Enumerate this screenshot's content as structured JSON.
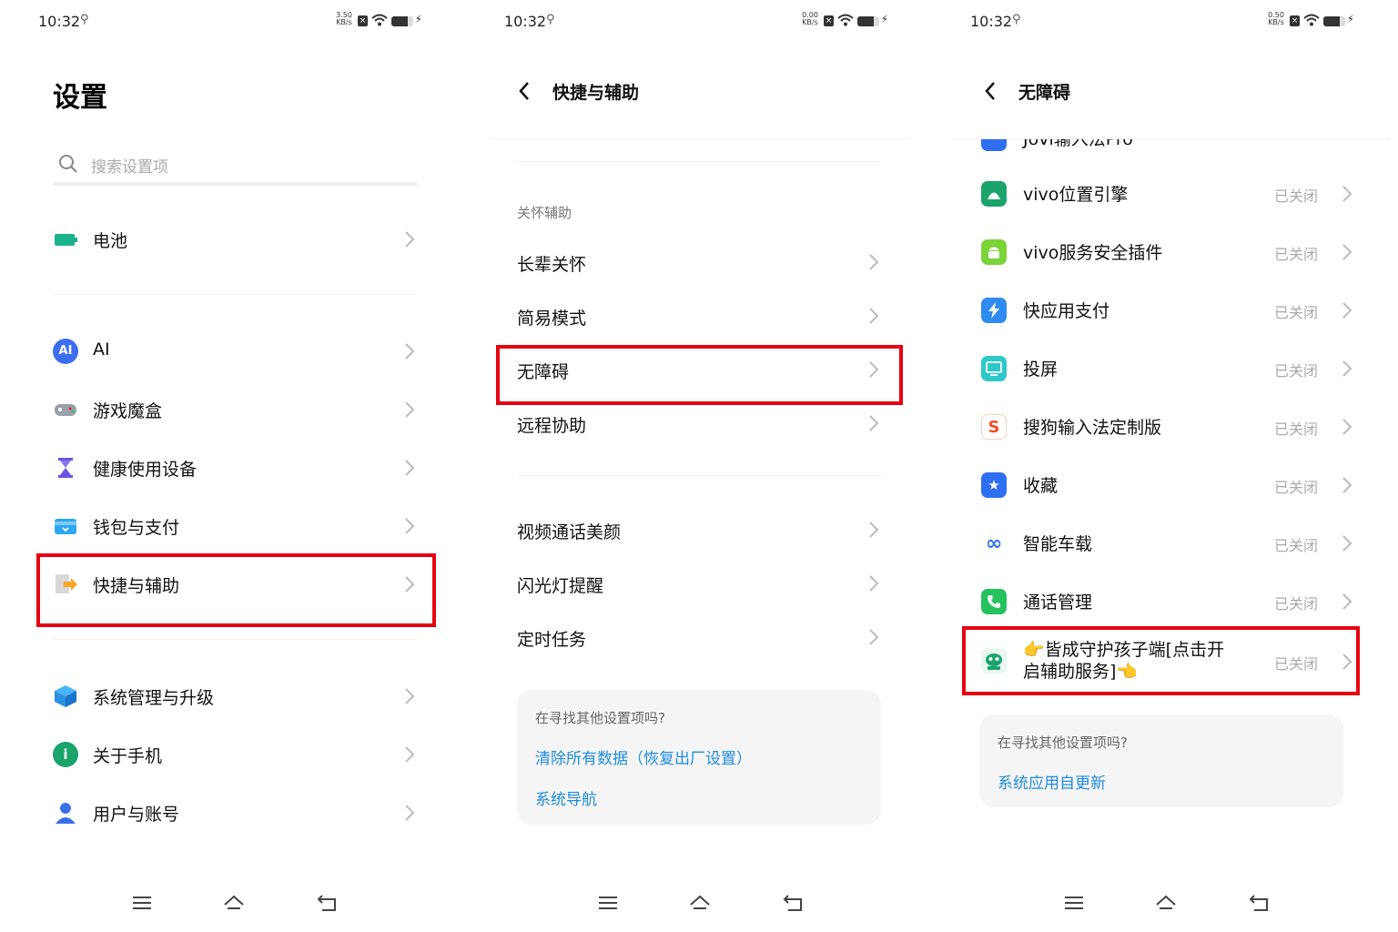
{
  "status": [
    {
      "time": "10:32",
      "net_speed": "3.50",
      "net_unit": "KB/s",
      "battery_level": 0.75
    },
    {
      "time": "10:32",
      "net_speed": "0.00",
      "net_unit": "KB/s",
      "battery_level": 0.75
    },
    {
      "time": "10:32",
      "net_speed": "0.50",
      "net_unit": "KB/s",
      "battery_level": 0.75
    }
  ],
  "settings": {
    "title": "设置",
    "search_placeholder": "搜索设置项",
    "items": [
      {
        "label": "电池",
        "icon": "battery-icon"
      },
      {
        "label": "AI",
        "icon": "ai-icon"
      },
      {
        "label": "游戏魔盒",
        "icon": "gamepad-icon"
      },
      {
        "label": "健康使用设备",
        "icon": "hourglass-icon"
      },
      {
        "label": "钱包与支付",
        "icon": "wallet-icon"
      },
      {
        "label": "快捷与辅助",
        "icon": "shortcut-icon"
      },
      {
        "label": "系统管理与升级",
        "icon": "system-icon"
      },
      {
        "label": "关于手机",
        "icon": "info-icon"
      },
      {
        "label": "用户与账号",
        "icon": "user-icon"
      }
    ]
  },
  "shortcuts": {
    "title": "快捷与辅助",
    "section_label": "关怀辅助",
    "items": [
      "长辈关怀",
      "简易模式",
      "无障碍",
      "远程协助",
      "视频通话美颜",
      "闪光灯提醒",
      "定时任务"
    ],
    "card": {
      "question": "在寻找其他设置项吗?",
      "links": [
        "清除所有数据（恢复出厂设置）",
        "系统导航"
      ]
    }
  },
  "accessibility": {
    "title": "无障碍",
    "partial_top_label": "Jovi输入法Pro",
    "items": [
      {
        "label": "vivo位置引擎",
        "state": "已关闭",
        "icon": "android-icon",
        "color": "#1aa36b"
      },
      {
        "label": "vivo服务安全插件",
        "state": "已关闭",
        "icon": "android-icon",
        "color": "#7bd438"
      },
      {
        "label": "快应用支付",
        "state": "已关闭",
        "icon": "lightning-icon",
        "color": "#2f8bf0"
      },
      {
        "label": "投屏",
        "state": "已关闭",
        "icon": "screen-cast-icon",
        "color": "#2fc8c8"
      },
      {
        "label": "搜狗输入法定制版",
        "state": "已关闭",
        "icon": "sogou-icon",
        "color": "#f04e23"
      },
      {
        "label": "收藏",
        "state": "已关闭",
        "icon": "star-icon",
        "color": "#2e6ff2"
      },
      {
        "label": "智能车载",
        "state": "已关闭",
        "icon": "infinity-icon",
        "color": "#2e6ff2"
      },
      {
        "label": "通话管理",
        "state": "已关闭",
        "icon": "phone-icon",
        "color": "#25c25d"
      },
      {
        "label_line1": "👉皆成守护孩子端[点击开",
        "label_line2": "启辅助服务]👈",
        "state": "已关闭",
        "icon": "monster-app-icon",
        "color": "#1aa36b"
      }
    ],
    "card": {
      "question": "在寻找其他设置项吗?",
      "link": "系统应用自更新"
    }
  },
  "colors": {
    "highlight": "#e60012",
    "link": "#1e8ce0"
  }
}
